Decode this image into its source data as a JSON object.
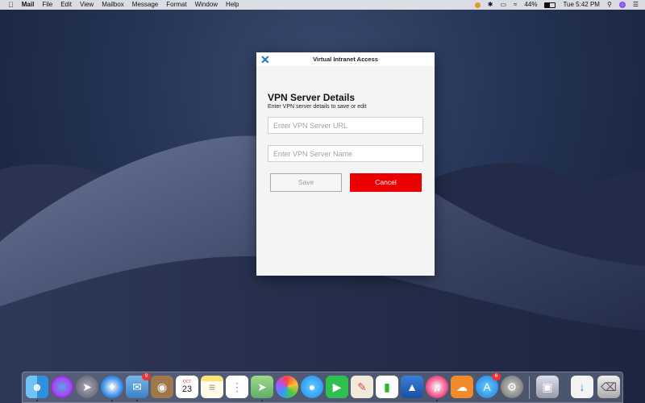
{
  "menubar": {
    "app_name": "Mail",
    "menus": [
      "File",
      "Edit",
      "View",
      "Mailbox",
      "Message",
      "Format",
      "Window",
      "Help"
    ],
    "battery": "44%",
    "clock": "Tue 5:42 PM"
  },
  "dialog": {
    "title": "Virtual Intranet Access",
    "heading": "VPN Server Details",
    "subheading": "Enter VPN server details to save or edit",
    "url_placeholder": "Enter VPN Server URL",
    "url_value": "",
    "name_placeholder": "Enter VPN Server Name",
    "name_value": "",
    "save_label": "Save",
    "cancel_label": "Cancel"
  },
  "colors": {
    "accent_blue": "#1e6fbf",
    "cancel_red": "#ee0000"
  },
  "dock": {
    "calendar_month": "OCT",
    "calendar_day": "23",
    "mail_badge": "9",
    "appstore_badge": "6"
  }
}
